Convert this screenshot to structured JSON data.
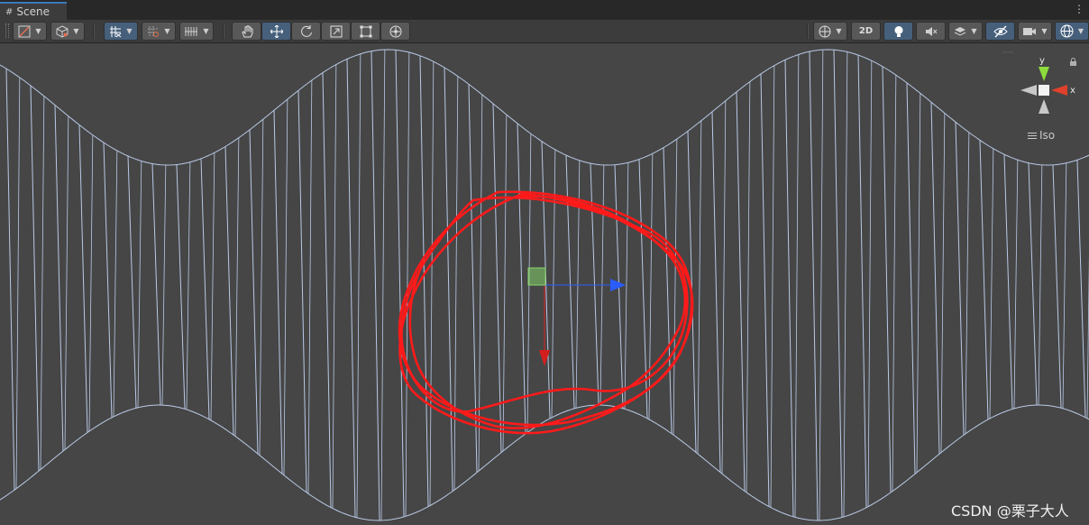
{
  "tab": {
    "title": "Scene",
    "icon": "grid-icon"
  },
  "menu": {
    "icon": "kebab-menu-icon",
    "glyph": "⋮"
  },
  "toolbar": {
    "left": [
      {
        "name": "draw-mode-dropdown",
        "icon": "draw-mode-icon"
      },
      {
        "name": "render-mode-dropdown",
        "icon": "cube-icon"
      },
      {
        "name": "grid-snap-dropdown",
        "icon": "grid-snap-icon",
        "active": true
      },
      {
        "name": "increment-snap-dropdown",
        "icon": "snap-increment-icon"
      },
      {
        "name": "grid-plane-dropdown",
        "icon": "grid-plane-icon"
      }
    ],
    "tools": [
      {
        "name": "hand-tool-button",
        "icon": "hand-icon"
      },
      {
        "name": "move-tool-button",
        "icon": "move-icon",
        "active": true
      },
      {
        "name": "rotate-tool-button",
        "icon": "rotate-icon"
      },
      {
        "name": "scale-tool-button",
        "icon": "scale-icon"
      },
      {
        "name": "rect-tool-button",
        "icon": "rect-icon"
      },
      {
        "name": "transform-tool-button",
        "icon": "transform-icon"
      }
    ],
    "right": [
      {
        "name": "gizmo-orientation-dropdown",
        "icon": "globe-icon"
      },
      {
        "name": "2d-toggle-button",
        "label": "2D"
      },
      {
        "name": "lighting-toggle-button",
        "icon": "lightbulb-icon",
        "active": true
      },
      {
        "name": "audio-toggle-button",
        "icon": "audio-mute-icon"
      },
      {
        "name": "effects-dropdown",
        "icon": "layers-icon"
      },
      {
        "name": "hidden-objects-toggle",
        "icon": "eye-hidden-icon",
        "active": true
      },
      {
        "name": "camera-dropdown",
        "icon": "camera-icon"
      },
      {
        "name": "gizmos-dropdown",
        "icon": "gizmo-sphere-icon",
        "active": true
      }
    ]
  },
  "scene_gizmo": {
    "axis_y": "y",
    "axis_x": "x",
    "projection": "Iso",
    "lock_icon": "lock-icon",
    "menu_icon": "hamburger-icon"
  },
  "colors": {
    "background": "#464646",
    "wire": "#b9c9e6",
    "annotation": "#ff1a1a",
    "axis_blue": "#2a5cff",
    "axis_red": "#e02020",
    "handle_green": "#84d46a"
  },
  "watermark": "CSDN @栗子大人"
}
